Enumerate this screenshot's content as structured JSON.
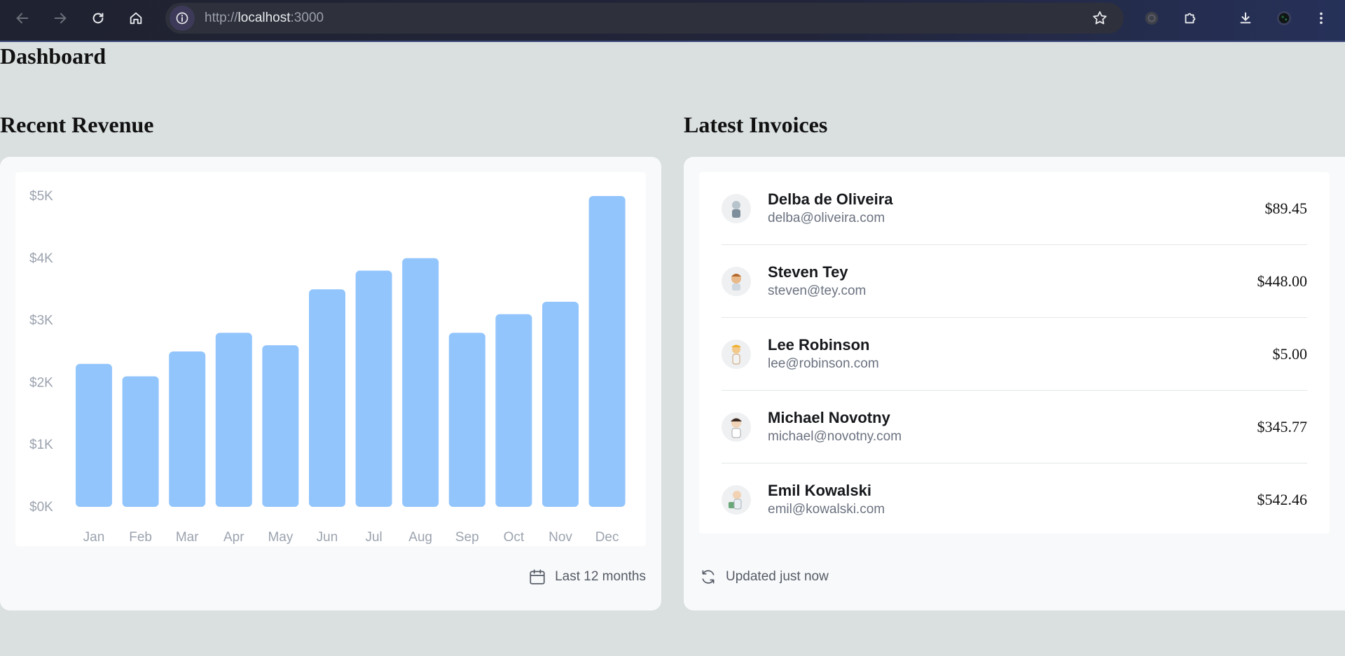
{
  "browser": {
    "url_scheme": "http://",
    "url_host": "localhost",
    "url_port": ":3000",
    "icons": [
      "back-arrow-icon",
      "forward-arrow-icon",
      "reload-icon",
      "home-icon",
      "site-info-icon",
      "star-icon",
      "extension-icon",
      "puzzle-icon",
      "download-icon",
      "profile-icon",
      "kebab-menu-icon"
    ]
  },
  "page": {
    "title": "Dashboard"
  },
  "revenue": {
    "title": "Recent Revenue",
    "footer_label": "Last 12 months",
    "footer_icon": "calendar-icon"
  },
  "invoices": {
    "title": "Latest Invoices",
    "footer_label": "Updated just now",
    "footer_icon": "refresh-icon",
    "items": [
      {
        "name": "Delba de Oliveira",
        "email": "delba@oliveira.com",
        "amount": "$89.45"
      },
      {
        "name": "Steven Tey",
        "email": "steven@tey.com",
        "amount": "$448.00"
      },
      {
        "name": "Lee Robinson",
        "email": "lee@robinson.com",
        "amount": "$5.00"
      },
      {
        "name": "Michael Novotny",
        "email": "michael@novotny.com",
        "amount": "$345.77"
      },
      {
        "name": "Emil Kowalski",
        "email": "emil@kowalski.com",
        "amount": "$542.46"
      }
    ]
  },
  "colors": {
    "bar": "#93c5fd",
    "tick": "#9ca3af"
  },
  "chart_data": {
    "type": "bar",
    "categories": [
      "Jan",
      "Feb",
      "Mar",
      "Apr",
      "May",
      "Jun",
      "Jul",
      "Aug",
      "Sep",
      "Oct",
      "Nov",
      "Dec"
    ],
    "values": [
      2300,
      2100,
      2500,
      2800,
      2600,
      3500,
      3800,
      4000,
      2800,
      3100,
      3300,
      5000
    ],
    "y_ticks": [
      "$5K",
      "$4K",
      "$3K",
      "$2K",
      "$1K",
      "$0K"
    ],
    "ylim": [
      0,
      5000
    ],
    "grid": false
  }
}
